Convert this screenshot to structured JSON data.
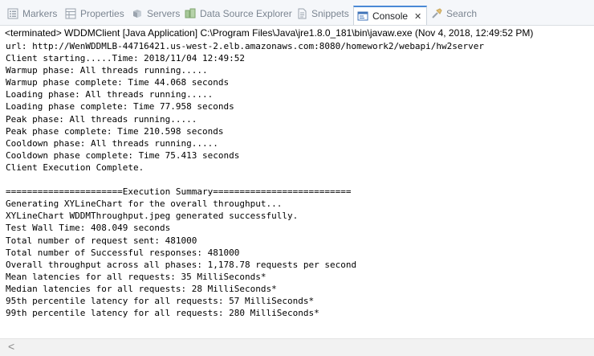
{
  "tabs": [
    {
      "label": "Markers",
      "icon": "markers-icon"
    },
    {
      "label": "Properties",
      "icon": "properties-icon"
    },
    {
      "label": "Servers",
      "icon": "servers-icon"
    },
    {
      "label": "Data Source Explorer",
      "icon": "data-source-explorer-icon"
    },
    {
      "label": "Snippets",
      "icon": "snippets-icon"
    },
    {
      "label": "Console",
      "icon": "console-icon",
      "active": true,
      "close": "✕"
    },
    {
      "label": "Search",
      "icon": "search-icon"
    }
  ],
  "status_line": "<terminated> WDDMClient [Java Application] C:\\Program Files\\Java\\jre1.8.0_181\\bin\\javaw.exe (Nov 4, 2018, 12:49:52 PM)",
  "console_lines": [
    "url: http://WenWDDMLB-44716421.us-west-2.elb.amazonaws.com:8080/homework2/webapi/hw2server",
    "Client starting.....Time: 2018/11/04 12:49:52",
    "Warmup phase: All threads running.....",
    "Warmup phase complete: Time 44.068 seconds",
    "Loading phase: All threads running.....",
    "Loading phase complete: Time 77.958 seconds",
    "Peak phase: All threads running.....",
    "Peak phase complete: Time 210.598 seconds",
    "Cooldown phase: All threads running.....",
    "Cooldown phase complete: Time 75.413 seconds",
    "Client Execution Complete.",
    "",
    "======================Execution Summary==========================",
    "Generating XYLineChart for the overall throughput...",
    "XYLineChart WDDMThroughput.jpeg generated successfully.",
    "Test Wall Time: 408.049 seconds",
    "Total number of request sent: 481000",
    "Total number of Successful responses: 481000",
    "Overall throughput across all phases: 1,178.78 requests per second",
    "Mean latencies for all requests: 35 MilliSeconds*",
    "Median latencies for all requests: 28 MilliSeconds*",
    "95th percentile latency for all requests: 57 MilliSeconds*",
    "99th percentile latency for all requests: 280 MilliSeconds*"
  ],
  "scroll_arrow": "<",
  "colors": {
    "active_tab_accent": "#4a89d6",
    "inactive_tab_text": "#7b8591",
    "tabbar_bg": "#f5f7fa"
  }
}
